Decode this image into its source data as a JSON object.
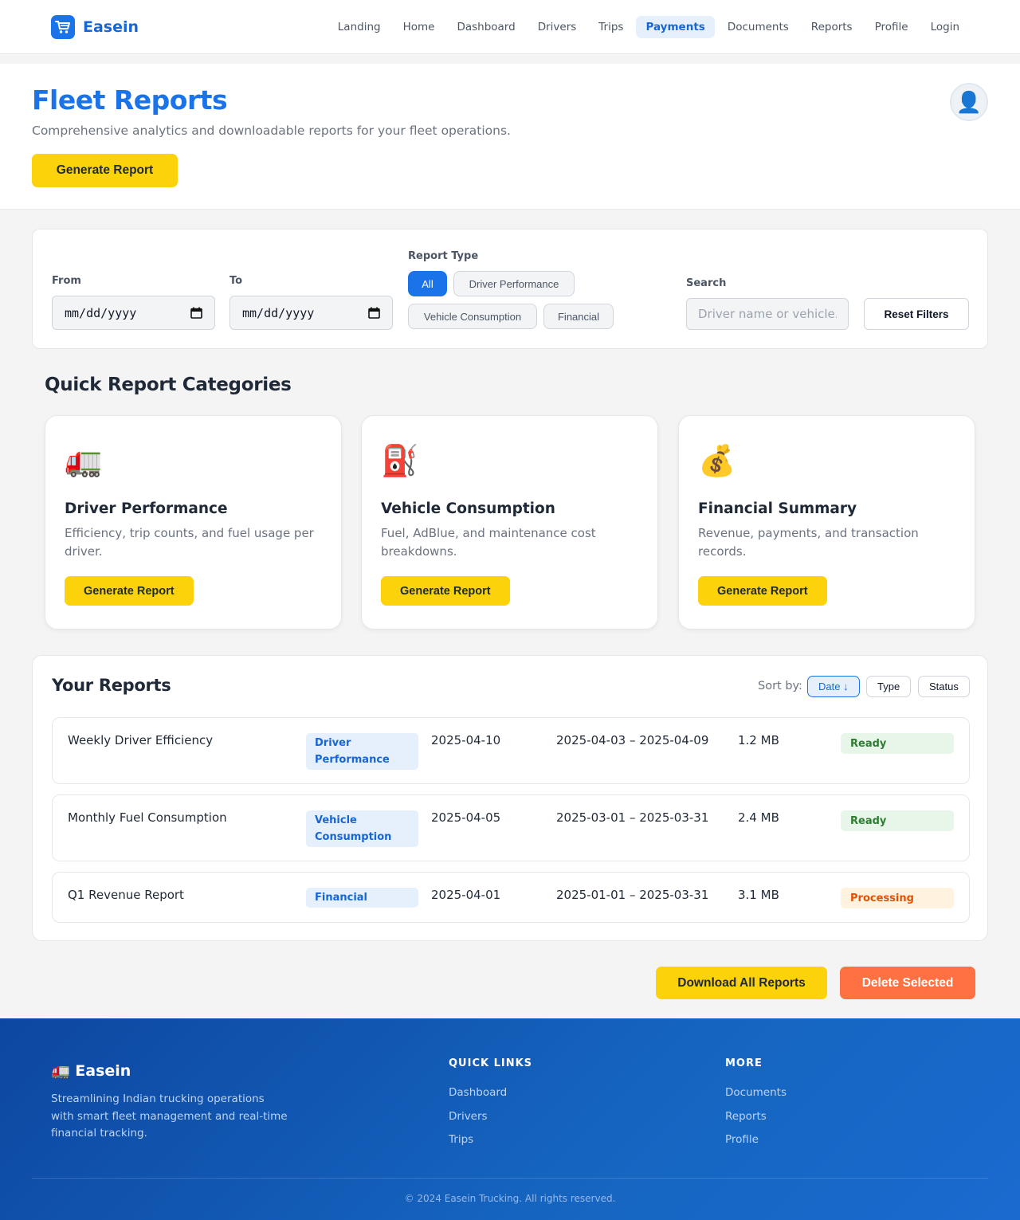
{
  "nav": {
    "brand": "Easein",
    "links": [
      "Landing",
      "Home",
      "Dashboard",
      "Drivers",
      "Trips",
      "Payments",
      "Documents",
      "Reports",
      "Profile",
      "Login"
    ],
    "active": "Payments"
  },
  "hero": {
    "title": "Fleet Reports",
    "subtitle": "Comprehensive analytics and downloadable reports for your fleet operations.",
    "generate_label": "Generate Report",
    "avatar_glyph": "👤"
  },
  "filters": {
    "from_label": "From",
    "to_label": "To",
    "from_value": "mm/dd/yyyy",
    "to_value": "mm/dd/yyyy",
    "report_type_label": "Report Type",
    "types": [
      "All",
      "Driver Performance",
      "Vehicle Consumption",
      "Financial"
    ],
    "selected_type": "All",
    "search_label": "Search",
    "search_placeholder": "Driver name or vehicle...",
    "reset_label": "Reset Filters"
  },
  "quick": {
    "title": "Quick Report Categories",
    "cards": [
      {
        "icon": "🚛",
        "title": "Driver Performance",
        "desc": "Efficiency, trip counts, and fuel usage per driver.",
        "button": "Generate Report"
      },
      {
        "icon": "⛽",
        "title": "Vehicle Consumption",
        "desc": "Fuel, AdBlue, and maintenance cost breakdowns.",
        "button": "Generate Report"
      },
      {
        "icon": "💰",
        "title": "Financial Summary",
        "desc": "Revenue, payments, and transaction records.",
        "button": "Generate Report"
      }
    ]
  },
  "reports": {
    "title": "Your Reports",
    "sort_label": "Sort by:",
    "sort_options": [
      "Date ↓",
      "Type",
      "Status"
    ],
    "active_sort": "Date ↓",
    "rows": [
      {
        "name": "Weekly Driver Efficiency",
        "type": "Driver Performance",
        "date": "2025-04-10",
        "range": "2025-04-03 – 2025-04-09",
        "size": "1.2 MB",
        "status": "Ready"
      },
      {
        "name": "Monthly Fuel Consumption",
        "type": "Vehicle Consumption",
        "date": "2025-04-05",
        "range": "2025-03-01 – 2025-03-31",
        "size": "2.4 MB",
        "status": "Ready"
      },
      {
        "name": "Q1 Revenue Report",
        "type": "Financial",
        "date": "2025-04-01",
        "range": "2025-01-01 – 2025-03-31",
        "size": "3.1 MB",
        "status": "Processing"
      }
    ]
  },
  "actions": {
    "download_all": "Download All Reports",
    "delete_selected": "Delete Selected"
  },
  "footer": {
    "brand": "🚛 Easein",
    "desc": "Streamlining Indian trucking operations with smart fleet management and real-time financial tracking.",
    "quick_links_title": "QUICK LINKS",
    "quick_links": [
      "Dashboard",
      "Drivers",
      "Trips"
    ],
    "more_title": "MORE",
    "more_links": [
      "Documents",
      "Reports",
      "Profile"
    ],
    "copyright": "© 2024 Easein Trucking. All rights reserved."
  },
  "colors": {
    "primary": "#1a73e8",
    "accent_yellow": "#fcd20a",
    "danger_orange": "#ff7043",
    "ready_green": "#2e7d32",
    "processing_orange": "#e65100"
  }
}
